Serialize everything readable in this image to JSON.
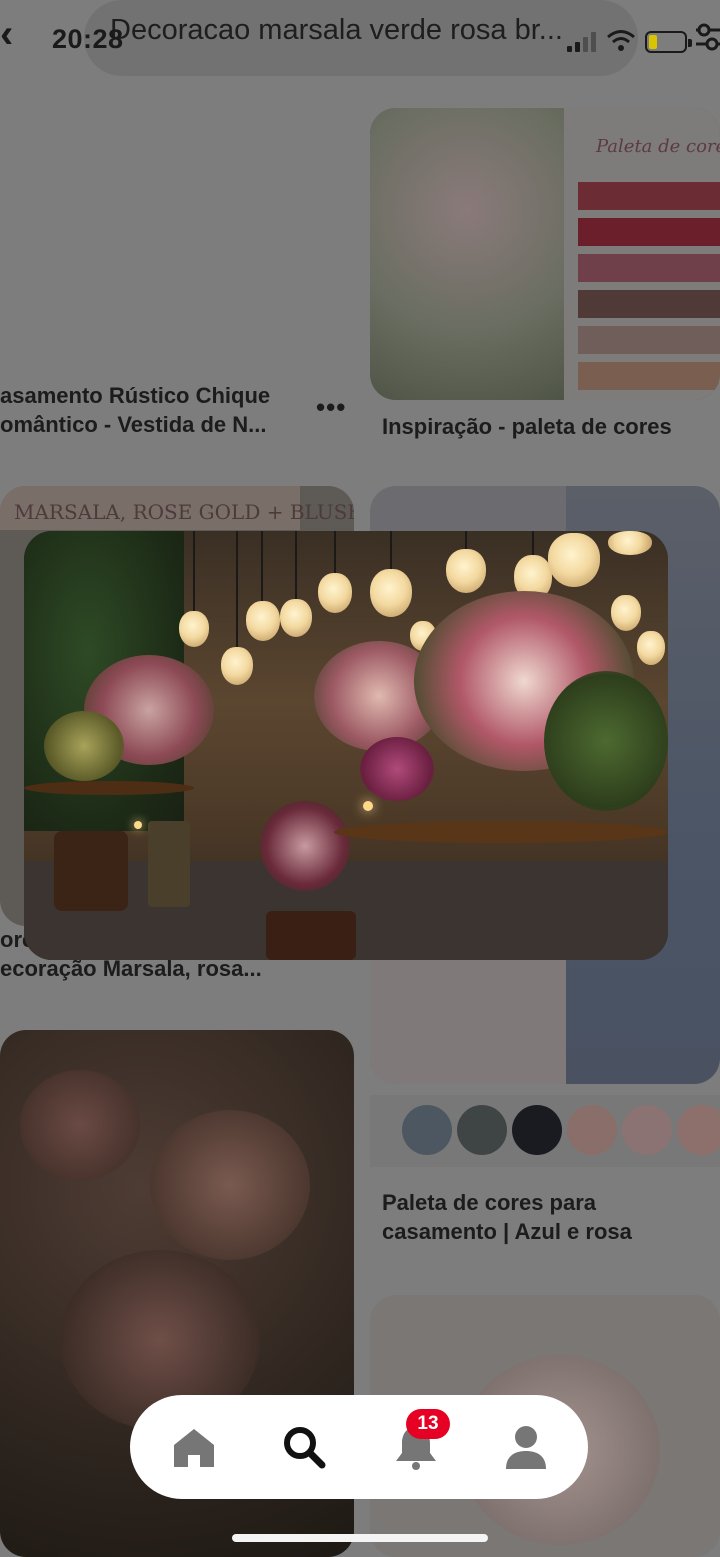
{
  "status_bar": {
    "time": "20:28"
  },
  "search": {
    "query": "Decoracao marsala verde rosa br..."
  },
  "pins": {
    "top_left_caption_line1": "asamento Rústico Chique",
    "top_left_caption_line2": "omântico - Vestida de N...",
    "top_right_caption": "Inspiração - paleta de cores",
    "top_right_palette_title": "Paleta de cores",
    "mid_left_band": "MARSALA, ROSE GOLD + BLUSH",
    "mid_left_caption_line1": "ore",
    "mid_left_caption_line2": "ecoração Marsala, rosa...",
    "mid_right_caption_line1": "Paleta de cores para",
    "mid_right_caption_line2": "casamento | Azul e rosa"
  },
  "palette_swatches": [
    "#6b2c34",
    "#6a1f2a",
    "#70404a",
    "#4f3a38",
    "#6f5e5a",
    "#7a5e50"
  ],
  "color_circles": [
    "#4d5761",
    "#3f4445",
    "#191b20",
    "#8a6e6a",
    "#8c7373",
    "#8d6f6c"
  ],
  "nav": {
    "notification_count": "13"
  }
}
